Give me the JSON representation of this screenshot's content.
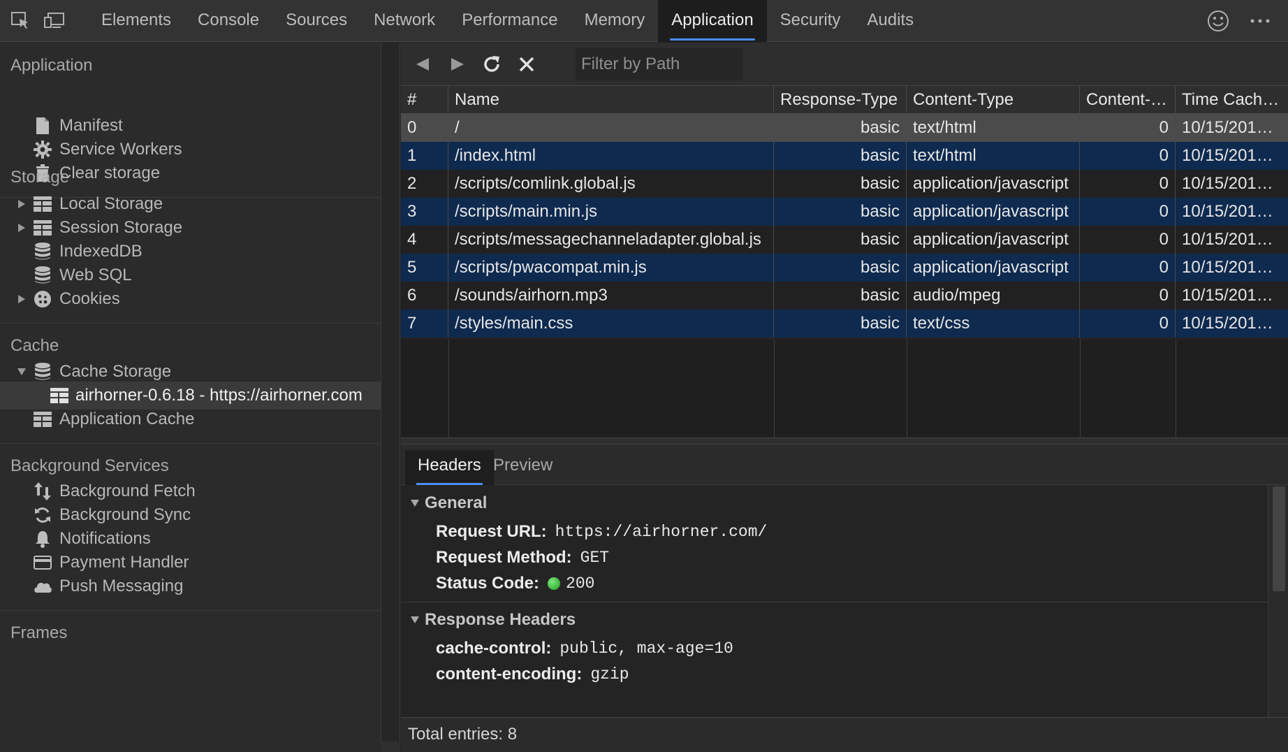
{
  "toolbar": {
    "tabs": [
      "Elements",
      "Console",
      "Sources",
      "Network",
      "Performance",
      "Memory",
      "Application",
      "Security",
      "Audits"
    ],
    "active_tab": "Application"
  },
  "sidebar": {
    "application_title": "Application",
    "application_items": [
      "Manifest",
      "Service Workers",
      "Clear storage"
    ],
    "storage_title": "Storage",
    "storage_items": [
      "Local Storage",
      "Session Storage",
      "IndexedDB",
      "Web SQL",
      "Cookies"
    ],
    "cache_title": "Cache",
    "cache_items": [
      "Cache Storage",
      "airhorner-0.6.18 - https://airhorner.com",
      "Application Cache"
    ],
    "background_title": "Background Services",
    "background_items": [
      "Background Fetch",
      "Background Sync",
      "Notifications",
      "Payment Handler",
      "Push Messaging"
    ],
    "frames_title": "Frames"
  },
  "main": {
    "filter_placeholder": "Filter by Path",
    "columns": [
      "#",
      "Name",
      "Response-Type",
      "Content-Type",
      "Content-…",
      "Time Cach…"
    ],
    "rows": [
      {
        "idx": "0",
        "name": "/",
        "rtype": "basic",
        "ctype": "text/html",
        "clen": "0",
        "time": "10/15/201…"
      },
      {
        "idx": "1",
        "name": "/index.html",
        "rtype": "basic",
        "ctype": "text/html",
        "clen": "0",
        "time": "10/15/201…"
      },
      {
        "idx": "2",
        "name": "/scripts/comlink.global.js",
        "rtype": "basic",
        "ctype": "application/javascript",
        "clen": "0",
        "time": "10/15/201…"
      },
      {
        "idx": "3",
        "name": "/scripts/main.min.js",
        "rtype": "basic",
        "ctype": "application/javascript",
        "clen": "0",
        "time": "10/15/201…"
      },
      {
        "idx": "4",
        "name": "/scripts/messagechanneladapter.global.js",
        "rtype": "basic",
        "ctype": "application/javascript",
        "clen": "0",
        "time": "10/15/201…"
      },
      {
        "idx": "5",
        "name": "/scripts/pwacompat.min.js",
        "rtype": "basic",
        "ctype": "application/javascript",
        "clen": "0",
        "time": "10/15/201…"
      },
      {
        "idx": "6",
        "name": "/sounds/airhorn.mp3",
        "rtype": "basic",
        "ctype": "audio/mpeg",
        "clen": "0",
        "time": "10/15/201…"
      },
      {
        "idx": "7",
        "name": "/styles/main.css",
        "rtype": "basic",
        "ctype": "text/css",
        "clen": "0",
        "time": "10/15/201…"
      }
    ],
    "detail_tabs": [
      "Headers",
      "Preview"
    ],
    "general_title": "General",
    "request_url_label": "Request URL:",
    "request_url_value": "https://airhorner.com/",
    "request_method_label": "Request Method:",
    "request_method_value": "GET",
    "status_code_label": "Status Code:",
    "status_code_value": "200",
    "status_color": "#2cc12c",
    "response_headers_title": "Response Headers",
    "cache_control_label": "cache-control:",
    "cache_control_value": "public, max-age=10",
    "content_encoding_label": "content-encoding:",
    "content_encoding_value": "gzip",
    "total_entries": "Total entries: 8"
  },
  "colors": {
    "accent": "#4a8ef0",
    "selected_row": "#4b4b4b",
    "alt_row": "#0f2a4f"
  }
}
